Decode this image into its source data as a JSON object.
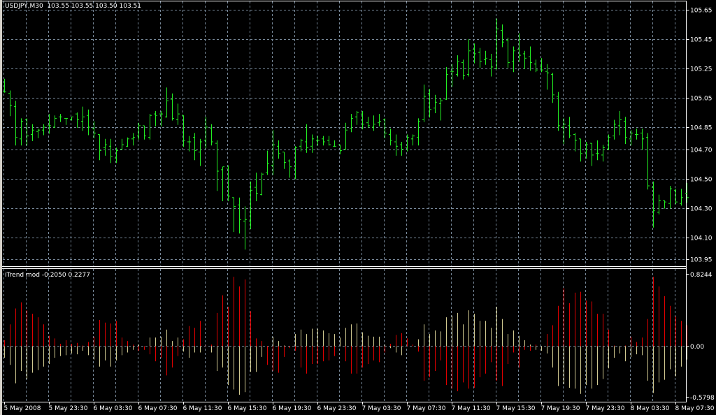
{
  "header": {
    "symbol": "USDJPY,M30",
    "quote": "103.55 103.55 103.50 103.51"
  },
  "indicator": {
    "name": "iTrend mod",
    "values": "-0.2050 0.2277"
  },
  "colors": {
    "background": "#000000",
    "bar": "#22ee22",
    "grid": "#778899",
    "positive_series": "#e00000",
    "negative_series": "#d0c890",
    "axis_text": "#ffffff"
  },
  "chart_data": [
    {
      "type": "ohlc",
      "title": "USDJPY,M30",
      "timeframe": "M30",
      "ylim": [
        103.95,
        105.65
      ],
      "y_ticks": [
        "105.65",
        "105.45",
        "105.25",
        "105.05",
        "104.85",
        "104.70",
        "104.50",
        "104.30",
        "104.10",
        "103.95"
      ],
      "x_ticks": [
        "5 May 2008",
        "5 May 23:30",
        "6 May 03:30",
        "6 May 07:30",
        "6 May 11:30",
        "6 May 15:30",
        "6 May 19:30",
        "6 May 23:30",
        "7 May 03:30",
        "7 May 07:30",
        "7 May 11:30",
        "7 May 15:30",
        "7 May 19:30",
        "7 May 23:30",
        "8 May 03:30",
        "8 May 07:30"
      ],
      "bars_per_x_tick": 8,
      "grid": true,
      "ohlc": [
        [
          105.09,
          105.18,
          105.09,
          105.09
        ],
        [
          105.08,
          105.1,
          104.93,
          105.0
        ],
        [
          104.99,
          105.03,
          104.73,
          104.78
        ],
        [
          104.77,
          104.91,
          104.73,
          104.89
        ],
        [
          104.9,
          104.91,
          104.73,
          104.79
        ],
        [
          104.8,
          104.87,
          104.76,
          104.83
        ],
        [
          104.82,
          104.84,
          104.78,
          104.83
        ],
        [
          104.83,
          104.87,
          104.8,
          104.85
        ],
        [
          104.86,
          104.94,
          104.81,
          104.86
        ],
        [
          104.85,
          104.93,
          104.85,
          104.91
        ],
        [
          104.92,
          104.94,
          104.89,
          104.92
        ],
        [
          104.91,
          104.91,
          104.87,
          104.91
        ],
        [
          104.9,
          104.92,
          104.9,
          104.92
        ],
        [
          104.94,
          104.95,
          104.85,
          104.9
        ],
        [
          104.89,
          104.99,
          104.83,
          104.92
        ],
        [
          104.93,
          104.97,
          104.8,
          104.85
        ],
        [
          104.84,
          104.89,
          104.78,
          104.81
        ],
        [
          104.8,
          104.8,
          104.63,
          104.69
        ],
        [
          104.71,
          104.77,
          104.66,
          104.73
        ],
        [
          104.72,
          104.77,
          104.61,
          104.65
        ],
        [
          104.64,
          104.71,
          104.61,
          104.69
        ],
        [
          104.7,
          104.77,
          104.7,
          104.73
        ],
        [
          104.72,
          104.78,
          104.72,
          104.77
        ],
        [
          104.77,
          104.81,
          104.73,
          104.78
        ],
        [
          104.79,
          104.88,
          104.77,
          104.86
        ],
        [
          104.86,
          104.86,
          104.77,
          104.79
        ],
        [
          104.78,
          104.94,
          104.77,
          104.93
        ],
        [
          104.94,
          104.96,
          104.86,
          104.93
        ],
        [
          104.94,
          104.96,
          104.86,
          104.94
        ],
        [
          104.92,
          105.12,
          104.92,
          105.03
        ],
        [
          105.04,
          105.08,
          104.9,
          104.91
        ],
        [
          104.9,
          105.01,
          104.87,
          104.94
        ],
        [
          104.93,
          104.93,
          104.72,
          104.76
        ],
        [
          104.75,
          104.79,
          104.69,
          104.75
        ],
        [
          104.78,
          104.81,
          104.63,
          104.69
        ],
        [
          104.68,
          104.77,
          104.59,
          104.75
        ],
        [
          104.76,
          104.92,
          104.71,
          104.85
        ],
        [
          104.84,
          104.87,
          104.73,
          104.75
        ],
        [
          104.74,
          104.76,
          104.42,
          104.55
        ],
        [
          104.56,
          104.58,
          104.35,
          104.58
        ],
        [
          104.57,
          104.59,
          104.35,
          104.38
        ],
        [
          104.37,
          104.37,
          104.14,
          104.31
        ],
        [
          104.32,
          104.37,
          104.13,
          104.22
        ],
        [
          104.21,
          104.31,
          104.02,
          104.22
        ],
        [
          104.21,
          104.48,
          104.16,
          104.42
        ],
        [
          104.44,
          104.54,
          104.35,
          104.4
        ],
        [
          104.39,
          104.54,
          104.39,
          104.53
        ],
        [
          104.54,
          104.69,
          104.53,
          104.6
        ],
        [
          104.59,
          104.83,
          104.53,
          104.73
        ],
        [
          104.72,
          104.76,
          104.64,
          104.67
        ],
        [
          104.68,
          104.68,
          104.57,
          104.61
        ],
        [
          104.62,
          104.63,
          104.51,
          104.58
        ],
        [
          104.57,
          104.72,
          104.5,
          104.71
        ],
        [
          104.72,
          104.77,
          104.69,
          104.76
        ],
        [
          104.75,
          104.87,
          104.68,
          104.71
        ],
        [
          104.72,
          104.8,
          104.68,
          104.77
        ],
        [
          104.76,
          104.79,
          104.73,
          104.76
        ],
        [
          104.77,
          104.79,
          104.73,
          104.75
        ],
        [
          104.76,
          104.79,
          104.73,
          104.73
        ],
        [
          104.72,
          104.76,
          104.72,
          104.72
        ],
        [
          104.73,
          104.73,
          104.67,
          104.69
        ],
        [
          104.7,
          104.88,
          104.7,
          104.83
        ],
        [
          104.84,
          104.94,
          104.82,
          104.91
        ],
        [
          104.92,
          104.96,
          104.87,
          104.95
        ],
        [
          104.94,
          104.96,
          104.84,
          104.87
        ],
        [
          104.88,
          104.92,
          104.85,
          104.86
        ],
        [
          104.85,
          104.93,
          104.83,
          104.87
        ],
        [
          104.88,
          104.94,
          104.86,
          104.89
        ],
        [
          104.9,
          104.91,
          104.78,
          104.81
        ],
        [
          104.8,
          104.84,
          104.73,
          104.76
        ],
        [
          104.75,
          104.8,
          104.66,
          104.72
        ],
        [
          104.73,
          104.75,
          104.66,
          104.7
        ],
        [
          104.71,
          104.8,
          104.69,
          104.78
        ],
        [
          104.77,
          104.8,
          104.73,
          104.79
        ],
        [
          104.78,
          104.91,
          104.73,
          104.89
        ],
        [
          104.9,
          105.14,
          104.89,
          105.06
        ],
        [
          105.08,
          105.11,
          104.92,
          104.97
        ],
        [
          104.98,
          105.07,
          104.95,
          105.02
        ],
        [
          105.01,
          105.05,
          104.9,
          105.03
        ],
        [
          105.04,
          105.26,
          105.04,
          105.21
        ],
        [
          105.23,
          105.28,
          105.13,
          105.23
        ],
        [
          105.21,
          105.34,
          105.2,
          105.3
        ],
        [
          105.29,
          105.31,
          105.18,
          105.2
        ],
        [
          105.21,
          105.45,
          105.2,
          105.37
        ],
        [
          105.38,
          105.42,
          105.29,
          105.35
        ],
        [
          105.36,
          105.39,
          105.26,
          105.3
        ],
        [
          105.31,
          105.37,
          105.28,
          105.32
        ],
        [
          105.31,
          105.35,
          105.2,
          105.26
        ],
        [
          105.25,
          105.59,
          105.25,
          105.52
        ],
        [
          105.51,
          105.55,
          105.4,
          105.43
        ],
        [
          105.44,
          105.46,
          105.26,
          105.29
        ],
        [
          105.3,
          105.4,
          105.23,
          105.37
        ],
        [
          105.38,
          105.49,
          105.3,
          105.34
        ],
        [
          105.35,
          105.37,
          105.25,
          105.32
        ],
        [
          105.33,
          105.4,
          105.24,
          105.29
        ],
        [
          105.28,
          105.31,
          105.23,
          105.24
        ],
        [
          105.26,
          105.32,
          105.23,
          105.24
        ],
        [
          105.23,
          105.28,
          105.11,
          105.22
        ],
        [
          105.21,
          105.22,
          105.02,
          105.07
        ],
        [
          105.06,
          105.09,
          104.83,
          104.86
        ],
        [
          104.85,
          104.91,
          104.74,
          104.87
        ],
        [
          104.86,
          104.92,
          104.78,
          104.79
        ],
        [
          104.8,
          104.81,
          104.69,
          104.76
        ],
        [
          104.77,
          104.77,
          104.62,
          104.67
        ],
        [
          104.68,
          104.75,
          104.64,
          104.73
        ],
        [
          104.74,
          104.74,
          104.59,
          104.66
        ],
        [
          104.67,
          104.76,
          104.63,
          104.67
        ],
        [
          104.66,
          104.73,
          104.62,
          104.71
        ],
        [
          104.7,
          104.8,
          104.7,
          104.78
        ],
        [
          104.79,
          104.9,
          104.77,
          104.87
        ],
        [
          104.86,
          104.96,
          104.8,
          104.9
        ],
        [
          104.89,
          104.92,
          104.74,
          104.78
        ],
        [
          104.77,
          104.83,
          104.73,
          104.81
        ],
        [
          104.8,
          104.84,
          104.77,
          104.8
        ],
        [
          104.81,
          104.84,
          104.7,
          104.77
        ],
        [
          104.78,
          104.81,
          104.43,
          104.45
        ],
        [
          104.44,
          104.48,
          104.17,
          104.28
        ],
        [
          104.27,
          104.39,
          104.26,
          104.35
        ],
        [
          104.35,
          104.35,
          104.3,
          104.34
        ],
        [
          104.33,
          104.45,
          104.3,
          104.43
        ],
        [
          104.42,
          104.43,
          104.33,
          104.34
        ],
        [
          104.33,
          104.43,
          104.32,
          104.37
        ],
        [
          104.4,
          104.47,
          104.34,
          104.37
        ]
      ]
    },
    {
      "type": "bar",
      "title": "iTrend mod",
      "ylim": [
        -0.5798,
        0.8244
      ],
      "y_ticks": [
        "0.8244",
        "0.00",
        "-0.5798"
      ],
      "series": [
        {
          "name": "red",
          "values": [
            0.08,
            0.26,
            0.44,
            0.51,
            0.42,
            0.38,
            0.34,
            0.26,
            0.13,
            0.1,
            0.04,
            0.08,
            0.04,
            0.05,
            0.02,
            0.06,
            0.12,
            0.31,
            0.28,
            0.27,
            0.3,
            0.11,
            0.07,
            0.03,
            -0.04,
            -0.03,
            -0.08,
            -0.16,
            -0.12,
            -0.32,
            -0.23,
            -0.1,
            0.09,
            0.24,
            0.22,
            0.3,
            0.02,
            0.03,
            0.39,
            0.59,
            0.46,
            0.8,
            0.69,
            0.77,
            0.41,
            0.1,
            0.07,
            -0.2,
            -0.27,
            -0.29,
            -0.11,
            -0.01,
            -0.04,
            -0.23,
            -0.3,
            -0.19,
            -0.19,
            -0.16,
            -0.15,
            -0.1,
            0,
            -0.16,
            -0.3,
            -0.3,
            -0.23,
            -0.19,
            -0.15,
            -0.17,
            -0.06,
            0.04,
            0.14,
            0.16,
            0.1,
            0.03,
            -0.05,
            -0.38,
            -0.34,
            -0.27,
            -0.15,
            -0.43,
            -0.47,
            -0.5,
            -0.4,
            -0.47,
            -0.46,
            -0.34,
            -0.3,
            -0.17,
            -0.38,
            -0.44,
            -0.19,
            -0.06,
            -0.23,
            -0.03,
            -0.04,
            0.03,
            0,
            0.15,
            0.25,
            0.47,
            0.67,
            0.5,
            0.62,
            0.63,
            0.53,
            0.52,
            0.38,
            0.38,
            0.2,
            0.02,
            -0.01,
            0.02,
            0.12,
            0.06,
            0.11,
            0.32,
            0.8,
            0.69,
            0.58,
            0.47,
            0.35,
            0.3,
            0.25
          ]
        },
        {
          "name": "khaki",
          "values": [
            -0.12,
            -0.2,
            -0.41,
            -0.27,
            -0.36,
            -0.29,
            -0.26,
            -0.22,
            -0.19,
            -0.12,
            -0.1,
            -0.09,
            -0.07,
            -0.08,
            -0.04,
            -0.09,
            -0.14,
            -0.22,
            -0.15,
            -0.22,
            -0.15,
            -0.09,
            -0.06,
            -0.03,
            0.03,
            0,
            0.11,
            0.11,
            0.12,
            0.2,
            0.07,
            0.11,
            -0.05,
            -0.12,
            -0.06,
            -0.06,
            0,
            -0.06,
            -0.27,
            -0.23,
            -0.43,
            -0.48,
            -0.54,
            -0.51,
            -0.28,
            -0.28,
            -0.11,
            0,
            0.12,
            0.07,
            0.02,
            0.01,
            0.15,
            0.2,
            0.15,
            0.21,
            0.21,
            0.19,
            0.16,
            0.15,
            0.11,
            0.22,
            0.26,
            0.27,
            0.17,
            0.13,
            0.12,
            0.12,
            0.03,
            -0.01,
            -0.06,
            -0.09,
            0,
            0,
            0.09,
            0.26,
            0.15,
            0.19,
            0.18,
            0.34,
            0.36,
            0.39,
            0.26,
            0.42,
            0.38,
            0.3,
            0.3,
            0.22,
            0.46,
            0.32,
            0.15,
            0.19,
            0.13,
            0.08,
            0.03,
            -0.03,
            -0.04,
            -0.07,
            -0.23,
            -0.44,
            -0.42,
            -0.46,
            -0.47,
            -0.53,
            -0.43,
            -0.47,
            -0.43,
            -0.36,
            -0.24,
            -0.12,
            -0.07,
            -0.16,
            -0.11,
            -0.08,
            -0.09,
            -0.38,
            -0.52,
            -0.4,
            -0.37,
            -0.25,
            -0.33,
            -0.22,
            -0.14
          ]
        }
      ]
    }
  ]
}
